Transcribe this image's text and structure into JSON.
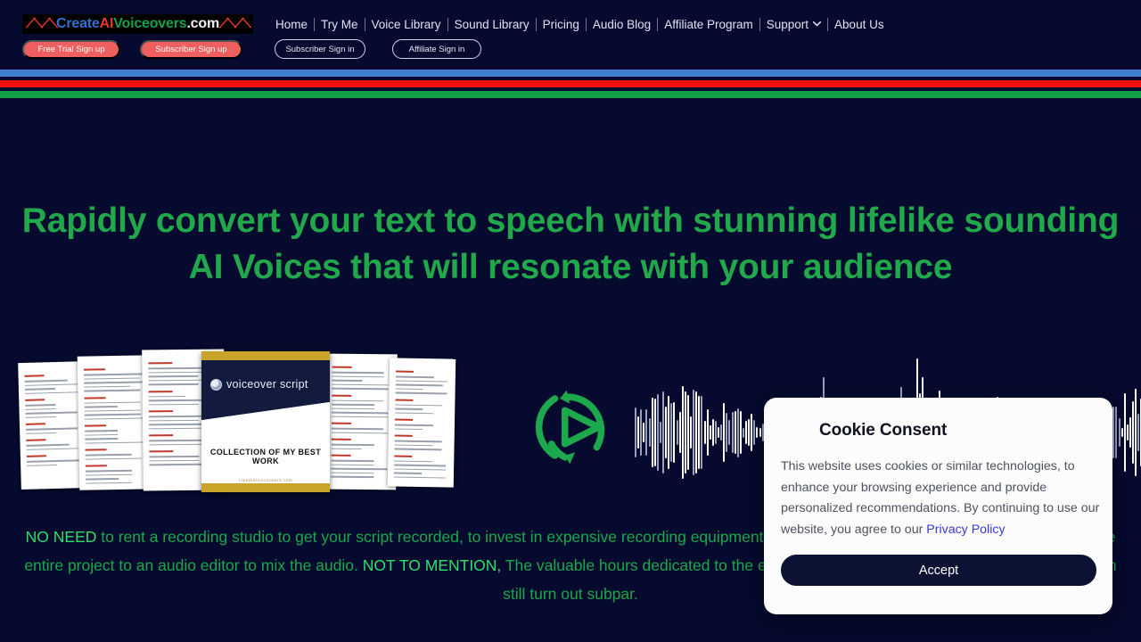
{
  "brand": {
    "logo_parts": [
      "Create",
      "AI",
      "Voiceovers",
      ".com"
    ],
    "wave_glyph": "waveform-icon"
  },
  "nav": {
    "links": [
      {
        "label": "Home",
        "icon": null
      },
      {
        "label": "Try Me",
        "icon": null
      },
      {
        "label": "Voice Library",
        "icon": null
      },
      {
        "label": "Sound Library",
        "icon": null
      },
      {
        "label": "Pricing",
        "icon": null
      },
      {
        "label": "Audio Blog",
        "icon": null
      },
      {
        "label": "Affiliate Program",
        "icon": null
      },
      {
        "label": "Support",
        "icon": "chevron-down-icon"
      },
      {
        "label": "About Us",
        "icon": null
      }
    ],
    "buttons": [
      {
        "label": "Free Trial Sign up",
        "style": "solid"
      },
      {
        "label": "Subscriber Sign up",
        "style": "solid"
      },
      {
        "label": "Subscriber Sign in",
        "style": "outline"
      },
      {
        "label": "Affiliate Sign in",
        "style": "outline"
      }
    ]
  },
  "stripes": {
    "blue": "#3f7fd0",
    "red": "#f2100e",
    "green": "#15a14a"
  },
  "hero": {
    "headline": "Rapidly convert your text to speech with stunning lifelike sounding AI Voices that will resonate with your audience",
    "headline_color": "#21a84b",
    "cover": {
      "title": "voiceover script",
      "caption": "COLLECTION OF MY BEST WORK",
      "footer": "createaivoiceovers.com"
    },
    "convert_icon": "convert-play-icon",
    "waveform": "audio-waveform-icon"
  },
  "subcopy": {
    "lead": "NO NEED",
    "part1": " to rent a recording studio to get your script recorded, to invest in expensive recording equipment (if recording at home), and recruit or outsource the entire project to an audio editor to mix the audio. ",
    "lead2": "NOT TO MENTION,",
    "part2": " The valuable hours dedicated to the entire process. Even after all this, the end result can still turn out subpar.",
    "color": "#18a94b"
  },
  "cookie": {
    "title": "Cookie Consent",
    "body_before_link": "This website uses cookies or similar technologies, to enhance your browsing experience and provide personalized recommendations. By continuing to use our website, you agree to our ",
    "link_label": "Privacy Policy",
    "accept_label": "Accept",
    "link_color": "#3a37e0",
    "button_color": "#0b1233"
  }
}
